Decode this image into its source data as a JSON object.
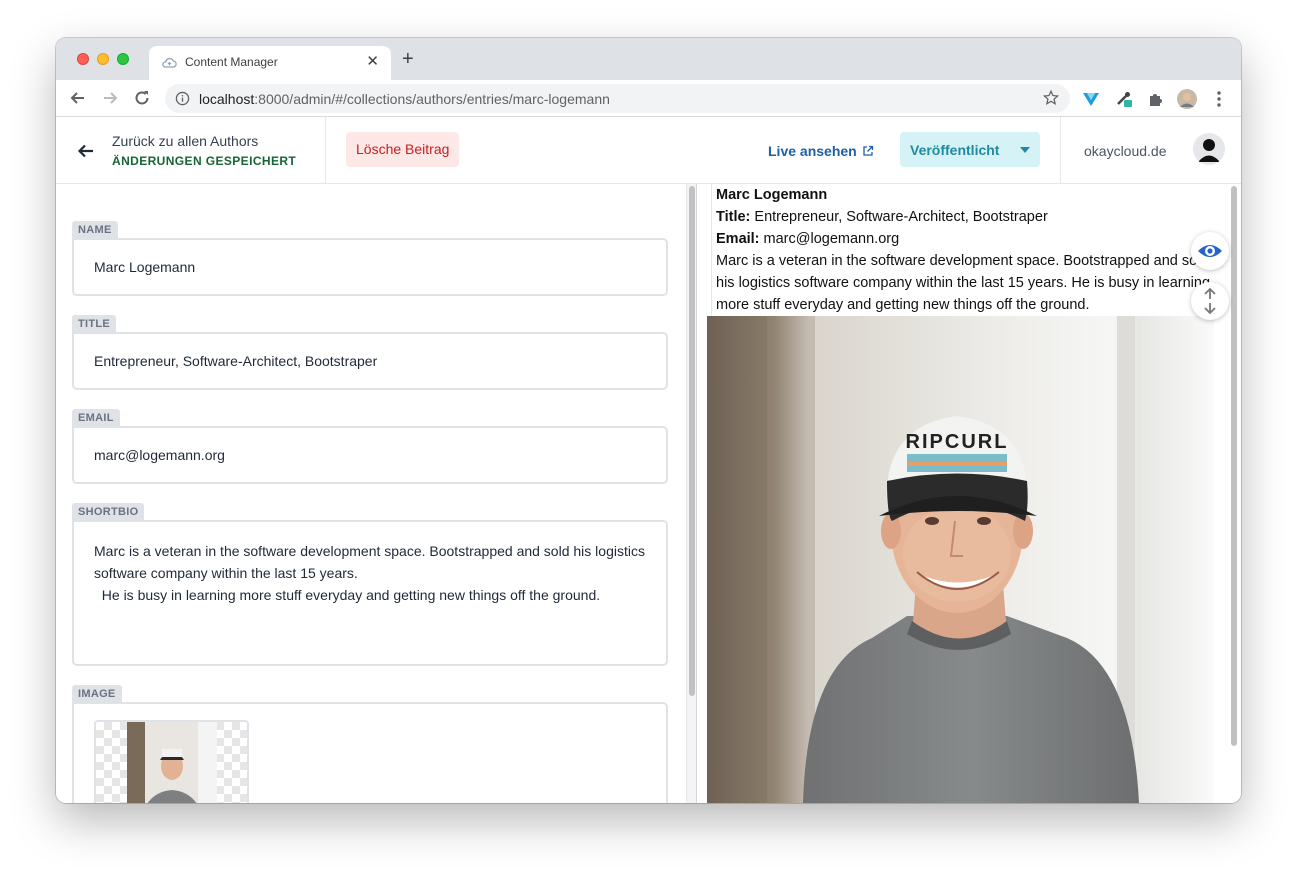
{
  "browser": {
    "tab_title": "Content Manager",
    "new_tab": "+",
    "close": "✕",
    "url_host": "localhost",
    "url_rest": ":8000/admin/#/collections/authors/entries/marc-logemann"
  },
  "header": {
    "back_label": "Zurück zu allen Authors",
    "status": "ÄNDERUNGEN GESPEICHERT",
    "delete_label": "Lösche Beitrag",
    "live_label": "Live ansehen",
    "publish_label": "Veröffentlicht",
    "site_name": "okaycloud.de"
  },
  "fields": {
    "name": {
      "label": "NAME",
      "value": "Marc Logemann"
    },
    "title": {
      "label": "TITLE",
      "value": "Entrepreneur, Software-Architect, Bootstraper"
    },
    "email": {
      "label": "EMAIL",
      "value": "marc@logemann.org"
    },
    "shortbio": {
      "label": "SHORTBIO",
      "value": "Marc is a veteran in the software development space. Bootstrapped and sold his logistics software company within the last 15 years.\n  He is busy in learning more stuff everyday and getting new things off the ground."
    },
    "image": {
      "label": "IMAGE"
    }
  },
  "preview": {
    "name": "Marc Logemann",
    "title_label": "Title:",
    "title_value": " Entrepreneur, Software-Architect, Bootstraper",
    "email_label": "Email:",
    "email_value": " marc@logemann.org",
    "bio": "Marc is a veteran in the software development space. Bootstrapped and sold his logistics software company within the last 15 years. He is busy in learning more stuff everyday and getting new things off the ground.",
    "cap_text": "RIPCURL"
  },
  "colors": {
    "saved_status": "#166534",
    "delete_bg": "#fde8e8",
    "delete_text": "#c81e1e",
    "publish_bg": "#d5f3f6",
    "publish_text": "#1f8aa0",
    "live_link": "#1e5fa8"
  }
}
